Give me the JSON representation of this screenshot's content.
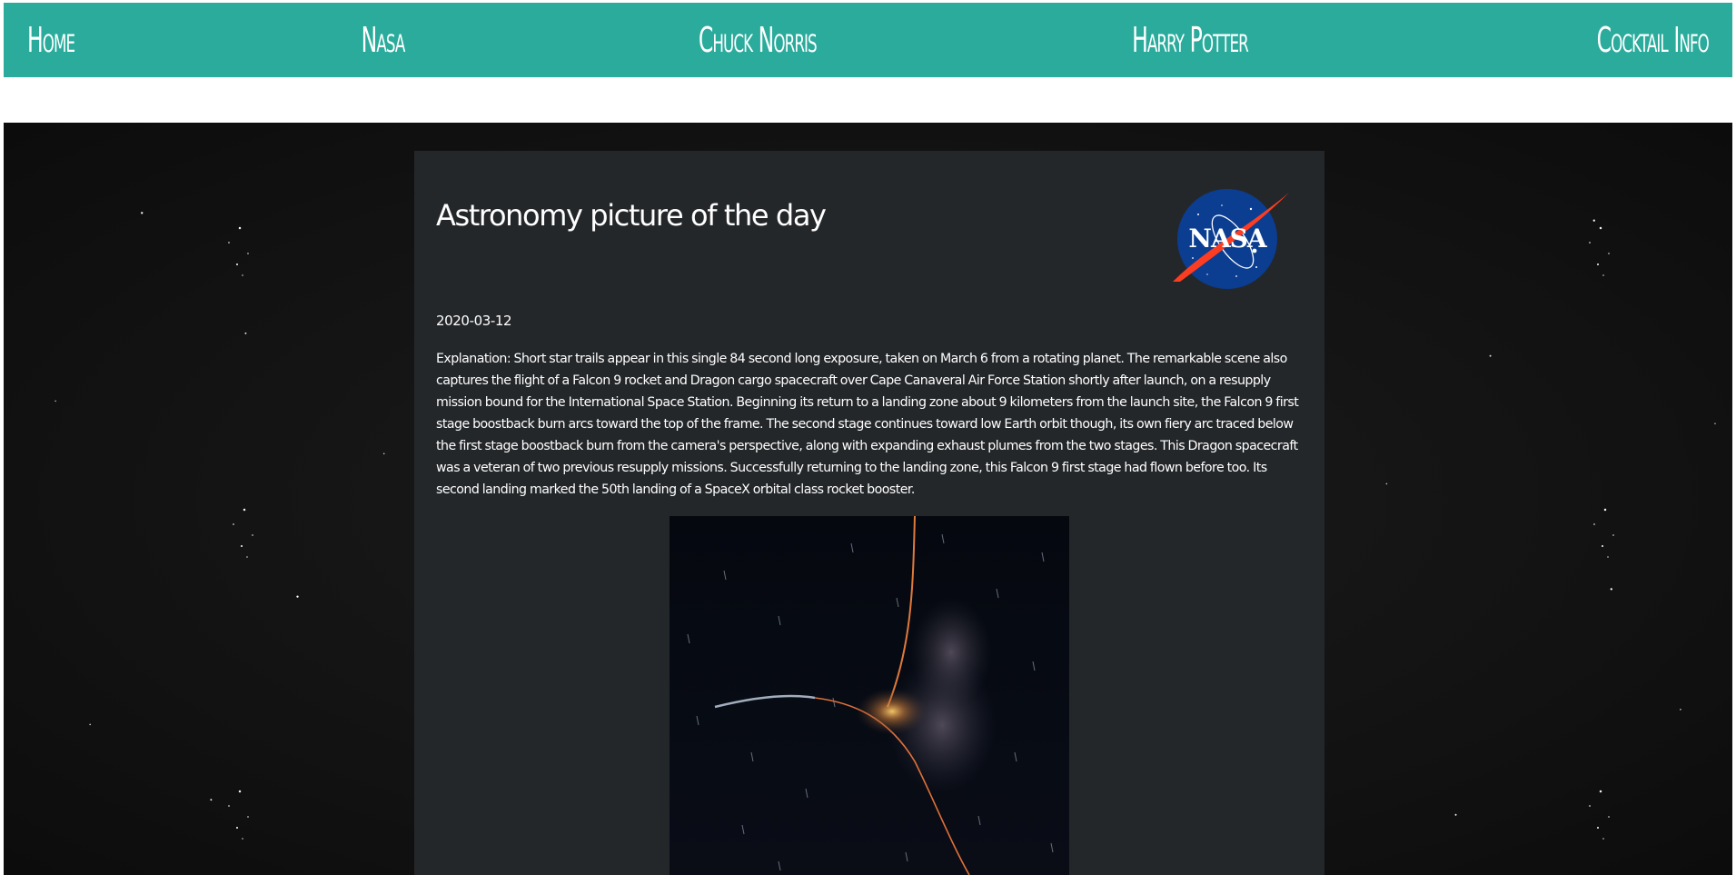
{
  "nav": {
    "links": [
      "Home",
      "Nasa",
      "Chuck Norris",
      "Harry Potter",
      "Cocktail Info"
    ]
  },
  "apod": {
    "title": "Astronomy picture of the day",
    "date": "2020-03-12",
    "explanation": "Explanation: Short star trails appear in this single 84 second long exposure, taken on March 6 from a rotating planet. The remarkable scene also captures the flight of a Falcon 9 rocket and Dragon cargo spacecraft over Cape Canaveral Air Force Station shortly after launch, on a resupply mission bound for the International Space Station. Beginning its return to a landing zone about 9 kilometers from the launch site, the Falcon 9 first stage boostback burn arcs toward the top of the frame. The second stage continues toward low Earth orbit though, its own fiery arc traced below the first stage boostback burn from the camera's perspective, along with expanding exhaust plumes from the two stages. This Dragon spacecraft was a veteran of two previous resupply missions. Successfully returning to the landing zone, this Falcon 9 first stage had flown before too. Its second landing marked the 50th landing of a SpaceX orbital class rocket booster.",
    "logo_text": "NASA"
  },
  "colors": {
    "nav_background": "#2aab9c",
    "card_background": "#24272a",
    "nasa_blue": "#0b3d91",
    "nasa_red": "#fc3d21"
  },
  "icons": {
    "logo": "nasa-meatball-logo"
  }
}
